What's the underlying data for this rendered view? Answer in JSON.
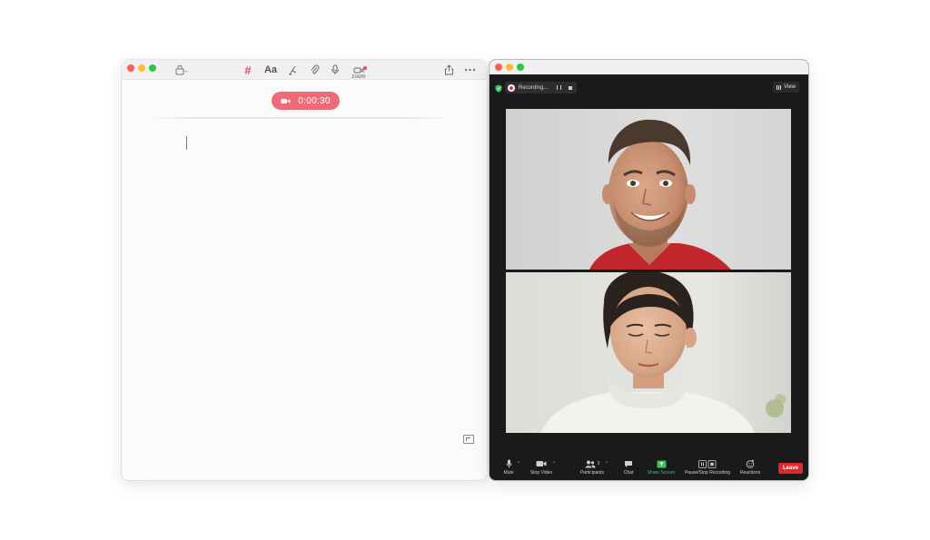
{
  "notes_app": {
    "recording_timer": "0:00:30",
    "toolbar_icons": [
      "lock-icon",
      "hashtag-icon",
      "text-format-icon",
      "sketch-icon",
      "attachment-icon",
      "microphone-icon",
      "zoom-integration-icon",
      "share-icon",
      "more-icon"
    ],
    "text_format_label": "Aa",
    "zoom_label": "zoom",
    "accent_color": "#ef6b77"
  },
  "zoom_app": {
    "recording_label": "Recording...",
    "view_label": "View",
    "participants_count": "2",
    "controls": {
      "mute": "Mute",
      "stop_video": "Stop Video",
      "participants": "Participants",
      "chat": "Chat",
      "share_screen": "Share Screen",
      "pause_stop_recording": "Pause/Stop Recording",
      "reactions": "Reactions"
    },
    "leave_label": "Leave",
    "leave_color": "#e02828",
    "share_color": "#35c759"
  }
}
